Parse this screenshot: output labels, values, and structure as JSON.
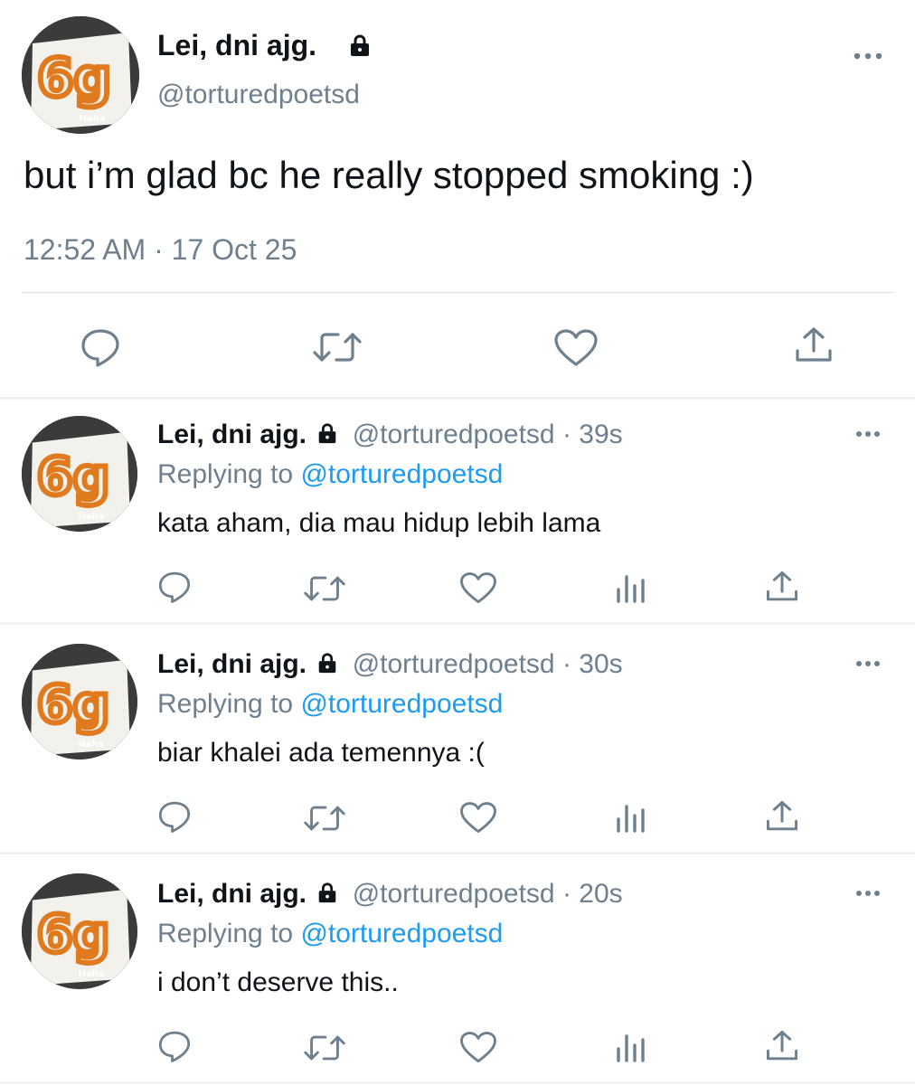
{
  "main_tweet": {
    "display_name": "Lei, dni ajg.",
    "handle": "@torturedpoetsd",
    "avatar_caption": "Haha",
    "avatar_text": "6g",
    "text": "but i’m glad bc he really stopped smoking :)",
    "timestamp": "12:52 AM · 17 Oct 25",
    "icons": [
      "reply-icon",
      "retweet-icon",
      "like-icon",
      "share-icon"
    ]
  },
  "replies": [
    {
      "display_name": "Lei, dni ajg.",
      "handle": "@torturedpoetsd",
      "time_ago": "· 39s",
      "replying_label": "Replying to",
      "replying_handle": "@torturedpoetsd",
      "text": "kata aham, dia mau hidup lebih lama",
      "avatar_caption": "Haha",
      "avatar_text": "6g"
    },
    {
      "display_name": "Lei, dni ajg.",
      "handle": "@torturedpoetsd",
      "time_ago": "· 30s",
      "replying_label": "Replying to",
      "replying_handle": "@torturedpoetsd",
      "text": "biar khalei ada temennya :(",
      "avatar_caption": "Haha",
      "avatar_text": "6g"
    },
    {
      "display_name": "Lei, dni ajg.",
      "handle": "@torturedpoetsd",
      "time_ago": "· 20s",
      "replying_label": "Replying to",
      "replying_handle": "@torturedpoetsd",
      "text": "i don’t deserve this..",
      "avatar_caption": "Haha",
      "avatar_text": "6g"
    }
  ],
  "colors": {
    "text": "#0f1419",
    "secondary": "#6e7f8d",
    "link": "#1d9bf0",
    "divider": "#eff3f4"
  }
}
